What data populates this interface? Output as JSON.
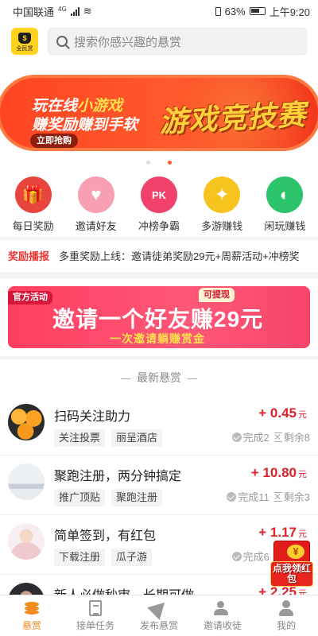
{
  "status_bar": {
    "carrier": "中国联通",
    "network": "4G",
    "battery_percent": "63%",
    "time": "上午9:20"
  },
  "header": {
    "logo_text": "全民赏",
    "search_placeholder": "搜索你感兴趣的悬赏"
  },
  "banner": {
    "line1_prefix": "玩在线",
    "line1_highlight": "小游戏",
    "line2": "赚奖励赚到手软",
    "cta": "立即抢购",
    "title": "游戏竞技赛",
    "page_count": 2,
    "active_page": 2
  },
  "shortcuts": [
    {
      "label": "每日奖励",
      "icon": "gift-icon",
      "color": "#e8453c",
      "glyph": "🎁"
    },
    {
      "label": "邀请好友",
      "icon": "heart-card-icon",
      "color": "#f7a0b4",
      "glyph": "♥"
    },
    {
      "label": "冲榜争霸",
      "icon": "pk-icon",
      "color": "#f2416a",
      "glyph": "PK"
    },
    {
      "label": "多游赚钱",
      "icon": "gamepad-icon",
      "color": "#f7c31f",
      "glyph": "✦"
    },
    {
      "label": "闲玩赚钱",
      "icon": "pacman-icon",
      "color": "#2bc46a",
      "glyph": "◐"
    }
  ],
  "ticker": {
    "label": "奖励播报",
    "text": "多重奖励上线：邀请徒弟奖励29元+周薪活动+冲榜奖"
  },
  "promo": {
    "tag": "官方活动",
    "badge": "可提现",
    "title": "邀请一个好友赚29元",
    "subtitle": "一次邀请躺赚赏金"
  },
  "section_title": "最新悬赏",
  "tasks": [
    {
      "title": "扫码关注助力",
      "tags": [
        "关注投票",
        "丽呈酒店"
      ],
      "reward": "+ 0.45",
      "unit": "元",
      "done": "完成2",
      "left": "剩余8",
      "thumb": "oranges"
    },
    {
      "title": "聚跑注册，两分钟搞定",
      "tags": [
        "推广顶贴",
        "聚跑注册"
      ],
      "reward": "+ 10.80",
      "unit": "元",
      "done": "完成11",
      "left": "剩余3",
      "thumb": "landscape"
    },
    {
      "title": "简单签到，有红包",
      "tags": [
        "下载注册",
        "瓜子游"
      ],
      "reward": "+ 1.17",
      "unit": "元",
      "done": "完成6",
      "left": "剩余7",
      "thumb": "portrait"
    },
    {
      "title": "新人必做秒审，长期可做",
      "tags": [],
      "reward": "+ 2.25",
      "unit": "元",
      "done": "",
      "left": "",
      "thumb": "dark"
    }
  ],
  "red_packet": {
    "label": "点我领红包",
    "coin": "¥"
  },
  "tabbar": [
    {
      "label": "悬赏",
      "icon": "coins-icon",
      "active": true
    },
    {
      "label": "接单任务",
      "icon": "document-icon",
      "active": false
    },
    {
      "label": "发布悬赏",
      "icon": "paper-plane-icon",
      "active": false
    },
    {
      "label": "邀请收徒",
      "icon": "users-icon",
      "active": false
    },
    {
      "label": "我的",
      "icon": "user-icon",
      "active": false
    }
  ],
  "colors": {
    "accent": "#f28a1e",
    "reward": "#e0202c",
    "banner": "#ff5a2b",
    "promo": "#ff4f70"
  }
}
